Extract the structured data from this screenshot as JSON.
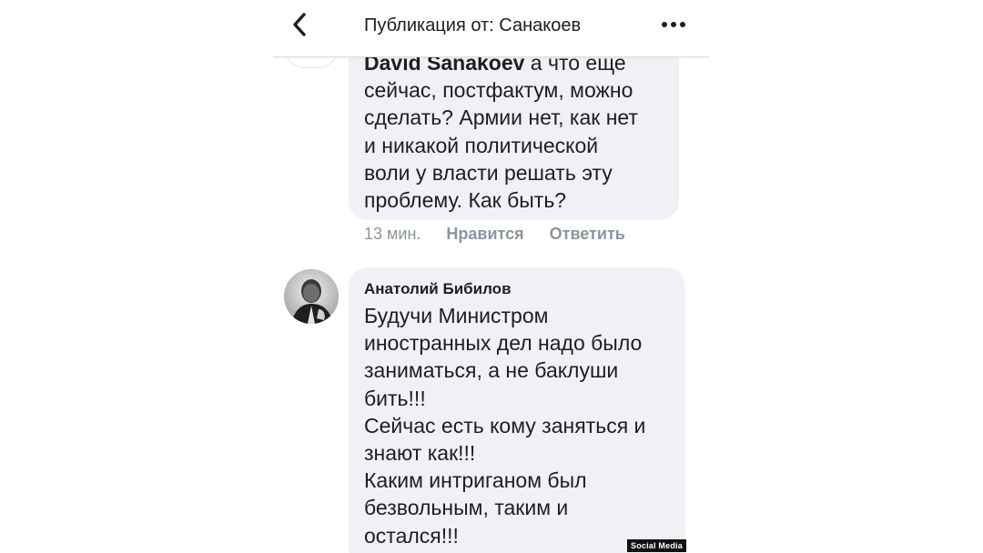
{
  "header": {
    "title": "Публикация от: Санакоев",
    "back_icon": "chevron-left-icon",
    "more_icon": "more-dots-icon"
  },
  "comments": [
    {
      "author": "David Sanakoev",
      "text": " а что еще\nсейчас, постфактум, можно\nсделать? Армии нет, как нет\nи никакой политической\nволи у власти решать эту\nпроблему. Как быть?",
      "time": "13 мин.",
      "like_label": "Нравится",
      "reply_label": "Ответить"
    },
    {
      "author": "Анатолий Бибилов",
      "text": "Будучи Министром\nиностранных дел  надо было\nзаниматься, а не баклуши\nбить!!!\nСейчас есть кому заняться и\nзнают как!!!\nКаким интриганом был\nбезвольным, таким и\nостался!!!"
    }
  ],
  "watermark": "Social Media",
  "colors": {
    "bubble": "#f0f1f4",
    "meta_text": "#8d949e",
    "text": "#1c1e21"
  }
}
